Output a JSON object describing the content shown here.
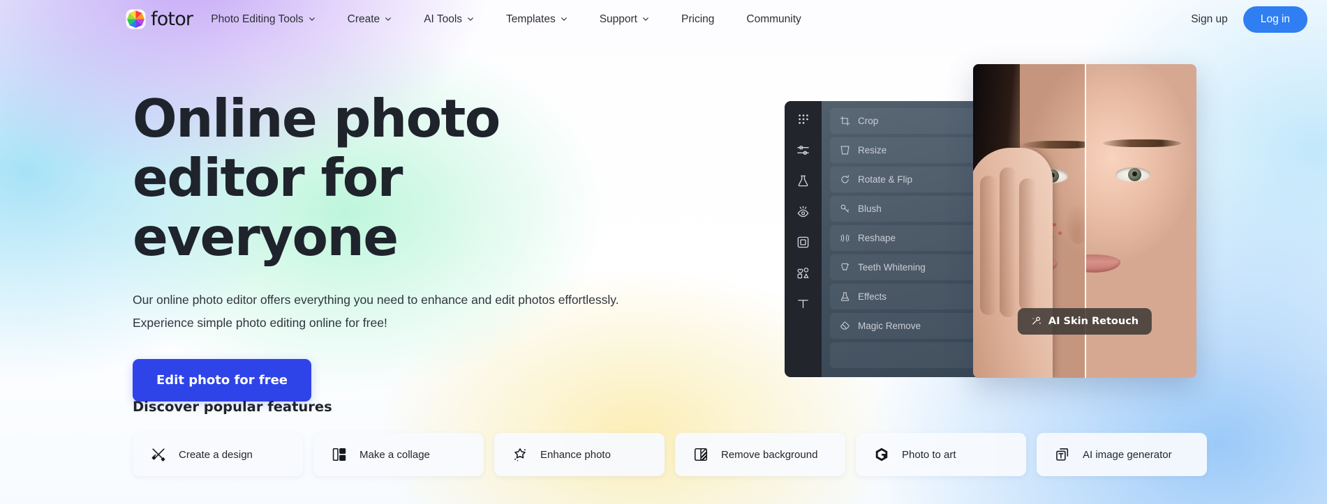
{
  "brand": {
    "name": "fotor",
    "logo_icon": "color-wheel-icon"
  },
  "nav": {
    "items": [
      {
        "label": "Photo Editing Tools",
        "has_dropdown": true
      },
      {
        "label": "Create",
        "has_dropdown": true
      },
      {
        "label": "AI Tools",
        "has_dropdown": true
      },
      {
        "label": "Templates",
        "has_dropdown": true
      },
      {
        "label": "Support",
        "has_dropdown": true
      },
      {
        "label": "Pricing",
        "has_dropdown": false
      },
      {
        "label": "Community",
        "has_dropdown": false
      }
    ],
    "signup_label": "Sign up",
    "login_label": "Log in",
    "login_color": "#2f7ef2"
  },
  "hero": {
    "title": "Online photo editor for everyone",
    "subtitle_line1": "Our online photo editor offers everything you need to enhance and edit photos effortlessly.",
    "subtitle_line2": "Experience simple photo editing online for free!",
    "cta_label": "Edit photo for free",
    "cta_color": "#2f44e8"
  },
  "editor_mock": {
    "rail_icons": [
      "grid-dots-icon",
      "sliders-icon",
      "beaker-icon",
      "eye-icon",
      "frame-icon",
      "shapes-icon",
      "text-icon"
    ],
    "tools": [
      {
        "label": "Crop",
        "icon": "crop-icon"
      },
      {
        "label": "Resize",
        "icon": "resize-icon"
      },
      {
        "label": "Rotate & Flip",
        "icon": "rotate-icon"
      },
      {
        "label": "Blush",
        "icon": "blush-icon"
      },
      {
        "label": "Reshape",
        "icon": "reshape-icon"
      },
      {
        "label": "Teeth Whitening",
        "icon": "tooth-icon"
      },
      {
        "label": "Effects",
        "icon": "effects-icon"
      },
      {
        "label": "Magic Remove",
        "icon": "eraser-icon"
      }
    ],
    "badge_label": "AI Skin Retouch",
    "badge_icon": "sparkle-wand-icon"
  },
  "features": {
    "title": "Discover popular features",
    "cards": [
      {
        "label": "Create a design",
        "icon": "pencil-cross-icon"
      },
      {
        "label": "Make a collage",
        "icon": "collage-icon"
      },
      {
        "label": "Enhance photo",
        "icon": "sparkle-star-icon"
      },
      {
        "label": "Remove background",
        "icon": "remove-bg-icon"
      },
      {
        "label": "Photo to art",
        "icon": "photo-to-art-icon"
      },
      {
        "label": "AI image generator",
        "icon": "ai-image-icon"
      }
    ]
  }
}
